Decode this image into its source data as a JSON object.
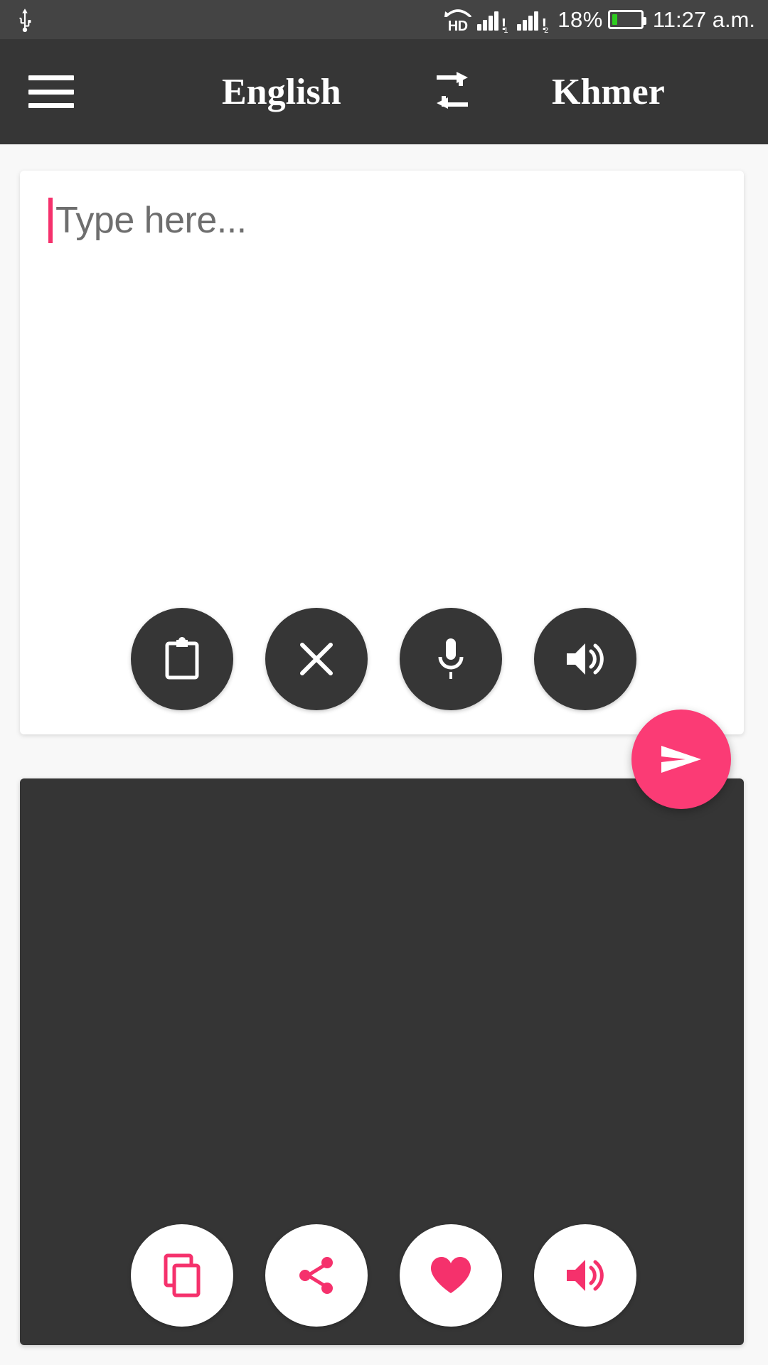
{
  "status_bar": {
    "usb_icon": "usb-icon",
    "hd_label": "HD",
    "sim1_icon": "signal-sim1-icon",
    "sim2_icon": "signal-sim2-icon",
    "sim1_label": "1",
    "sim2_label": "2",
    "alert_mark": "!",
    "battery_percent": "18%",
    "battery_level": 18,
    "battery_icon": "battery-icon",
    "time": "11:27 a.m."
  },
  "header": {
    "menu_icon": "hamburger-menu-icon",
    "source_language": "English",
    "swap_icon": "swap-languages-icon",
    "target_language": "Khmer"
  },
  "input_area": {
    "placeholder": "Type here...",
    "value": "",
    "cursor_color": "#f5316c",
    "actions": [
      {
        "name": "paste-button",
        "icon": "clipboard-icon",
        "label": "Paste"
      },
      {
        "name": "clear-button",
        "icon": "close-icon",
        "label": "Clear"
      },
      {
        "name": "microphone-button",
        "icon": "microphone-icon",
        "label": "Voice input"
      },
      {
        "name": "speak-button",
        "icon": "speaker-icon",
        "label": "Speak"
      }
    ]
  },
  "send_button": {
    "icon": "send-icon",
    "label": "Translate",
    "color": "#fb3b75"
  },
  "output_area": {
    "text": "",
    "actions": [
      {
        "name": "copy-button",
        "icon": "copy-icon",
        "label": "Copy"
      },
      {
        "name": "share-button",
        "icon": "share-icon",
        "label": "Share"
      },
      {
        "name": "favorite-button",
        "icon": "heart-icon",
        "label": "Favorite"
      },
      {
        "name": "speak-button",
        "icon": "speaker-icon",
        "label": "Speak"
      }
    ]
  },
  "theme": {
    "dark": "#363636",
    "status_bar": "#444444",
    "accent_pink": "#fb3b75",
    "page_background": "#f8f8f8",
    "card_background": "#ffffff"
  }
}
